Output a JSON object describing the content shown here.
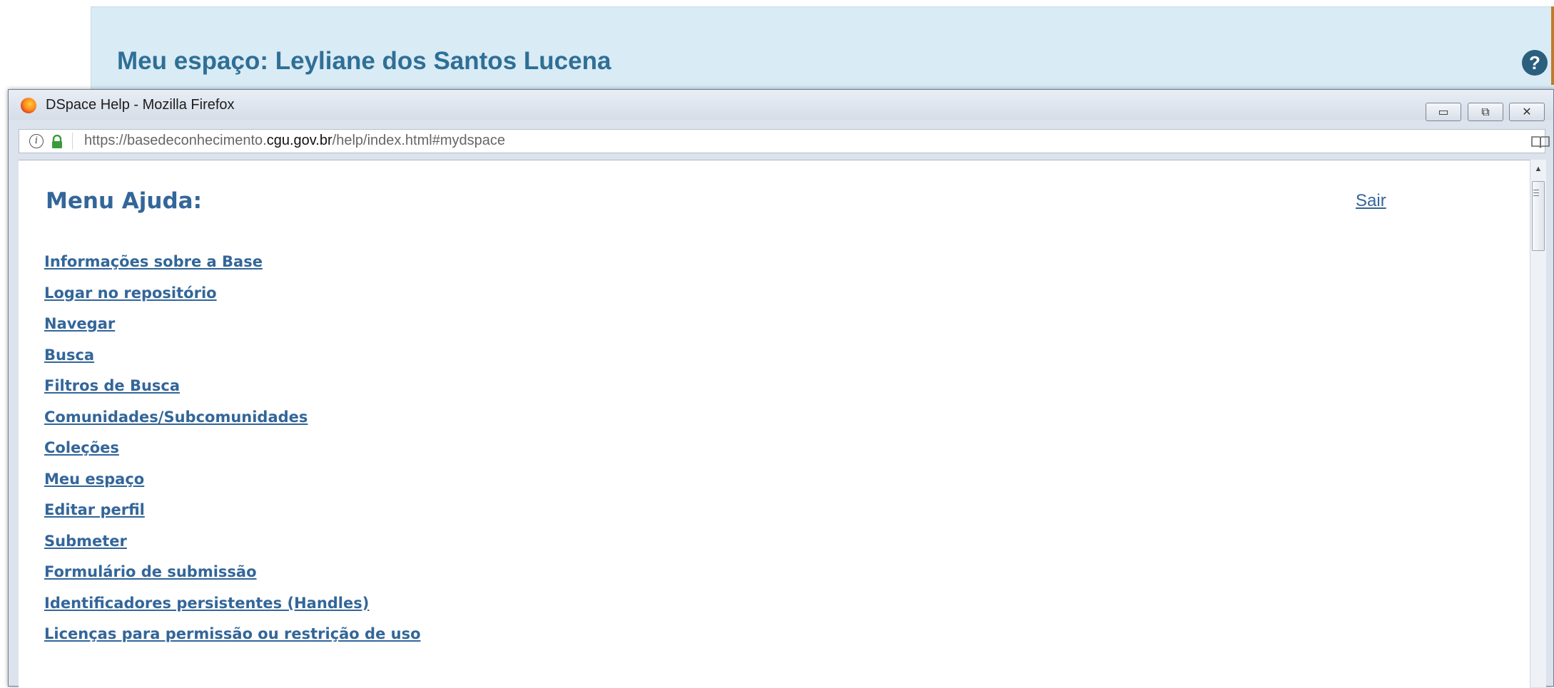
{
  "background_page": {
    "title": "Meu espaço: Leyliane dos Santos Lucena",
    "help_icon": "question-circle-icon",
    "help_glyph": "?"
  },
  "window": {
    "title": "DSpace Help - Mozilla Firefox",
    "browser_icon": "firefox-icon",
    "controls": {
      "minimize_icon": "minimize-icon",
      "minimize_glyph": "▭",
      "maximize_icon": "restore-icon",
      "maximize_glyph": "⧉",
      "close_icon": "close-icon",
      "close_glyph": "✕"
    }
  },
  "urlbar": {
    "url_prefix": "https://basedeconhecimento.",
    "url_domain": "cgu.gov.br",
    "url_path": "/help/index.html#mydspace",
    "info_icon": "info-icon",
    "info_glyph": "i",
    "lock_icon": "lock-icon",
    "reader_icon": "reader-view-icon"
  },
  "help": {
    "menu_title": "Menu Ajuda:",
    "exit_label": "Sair",
    "items": [
      "Informações sobre a Base",
      "Logar no repositório",
      "Navegar",
      "Busca",
      "Filtros de Busca",
      "Comunidades/Subcomunidades",
      "Coleções",
      "Meu espaço",
      "Editar perfil",
      "Submeter",
      "Formulário de submissão",
      "Identificadores persistentes (Handles)",
      "Licenças para permissão ou restrição de uso"
    ]
  },
  "scrollbar": {
    "up_glyph": "▲"
  },
  "colors": {
    "link": "#336699",
    "header_bg": "#d9ebf5",
    "header_title": "#2f6f96"
  }
}
